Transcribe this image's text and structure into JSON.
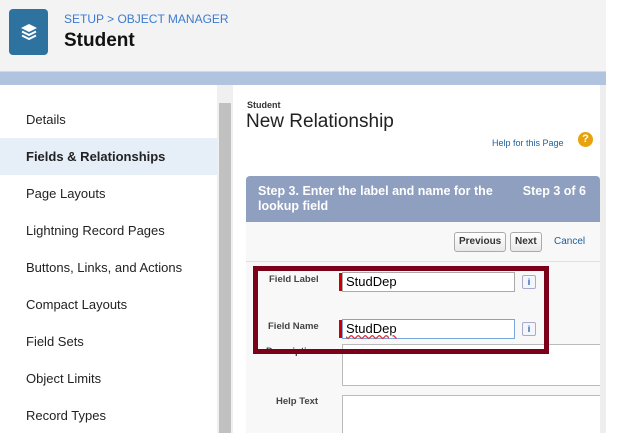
{
  "header": {
    "breadcrumb": "SETUP > OBJECT MANAGER",
    "title": "Student",
    "logo_icon": "layers-icon"
  },
  "sidebar": {
    "items": [
      {
        "label": "Details"
      },
      {
        "label": "Fields & Relationships",
        "active": true
      },
      {
        "label": "Page Layouts"
      },
      {
        "label": "Lightning Record Pages"
      },
      {
        "label": "Buttons, Links, and Actions"
      },
      {
        "label": "Compact Layouts"
      },
      {
        "label": "Field Sets"
      },
      {
        "label": "Object Limits"
      },
      {
        "label": "Record Types"
      }
    ]
  },
  "main": {
    "object": "Student",
    "title": "New Relationship",
    "help_link": "Help for this Page",
    "help_icon": "?",
    "step_title": "Step 3. Enter the label and name for the lookup field",
    "step_counter": "Step 3 of 6",
    "buttons": {
      "previous": "Previous",
      "next": "Next",
      "cancel": "Cancel"
    },
    "fields": {
      "field_label": {
        "label": "Field Label",
        "value": "StudDep"
      },
      "field_name": {
        "label": "Field Name",
        "value": "StudDep"
      },
      "description": {
        "label": "Description"
      },
      "help_text": {
        "label": "Help Text"
      }
    },
    "info_icon": "i"
  },
  "colors": {
    "accent": "#2e729f",
    "highlight": "#7b0019",
    "step_header": "#8f9fbf"
  }
}
